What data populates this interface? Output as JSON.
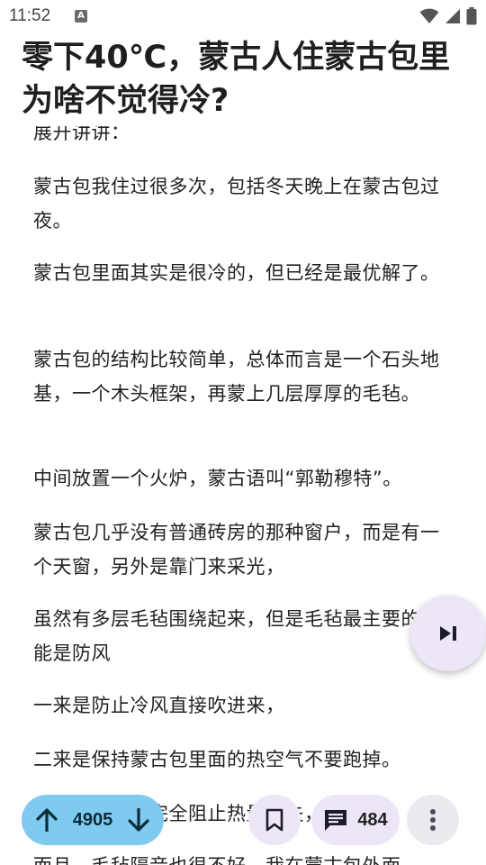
{
  "status_bar": {
    "time": "11:52",
    "notification_letter": "A"
  },
  "article": {
    "title": "零下40℃，蒙古人住蒙古包里为啥不觉得冷?",
    "partial_top_text": "展开讲讲：",
    "paragraphs": [
      "蒙古包我住过很多次，包括冬天晚上在蒙古包过夜。",
      "蒙古包里面其实是很冷的，但已经是最优解了。",
      "蒙古包的结构比较简单，总体而言是一个石头地基，一个木头框架，再蒙上几层厚厚的毛毡。",
      "中间放置一个火炉，蒙古语叫“郭勒穆特”。",
      "蒙古包几乎没有普通砖房的那种窗户，而是有一个天窗，另外是靠门来采光，",
      "虽然有多层毛毡围绕起来，但是毛毡最主要的功能是防风",
      "一来是防止冷风直接吹进来，",
      "二来是保持蒙古包里面的热空气不要跑掉。"
    ],
    "partial_bottom_text": "但毛毡并不能完全阻止热量散失，",
    "partial_last_text": "而且，毛毡隔音也很不好，我在蒙古包外面"
  },
  "actions": {
    "vote_count": "4905",
    "comment_count": "484"
  },
  "icons": {
    "next": "skip-next-icon",
    "upvote": "arrow-up-icon",
    "downvote": "arrow-down-icon",
    "bookmark": "bookmark-icon",
    "comment": "comment-icon",
    "more": "more-vertical-icon"
  },
  "colors": {
    "vote_pill": "#7ecbef",
    "button_bg": "#ece6f6"
  }
}
